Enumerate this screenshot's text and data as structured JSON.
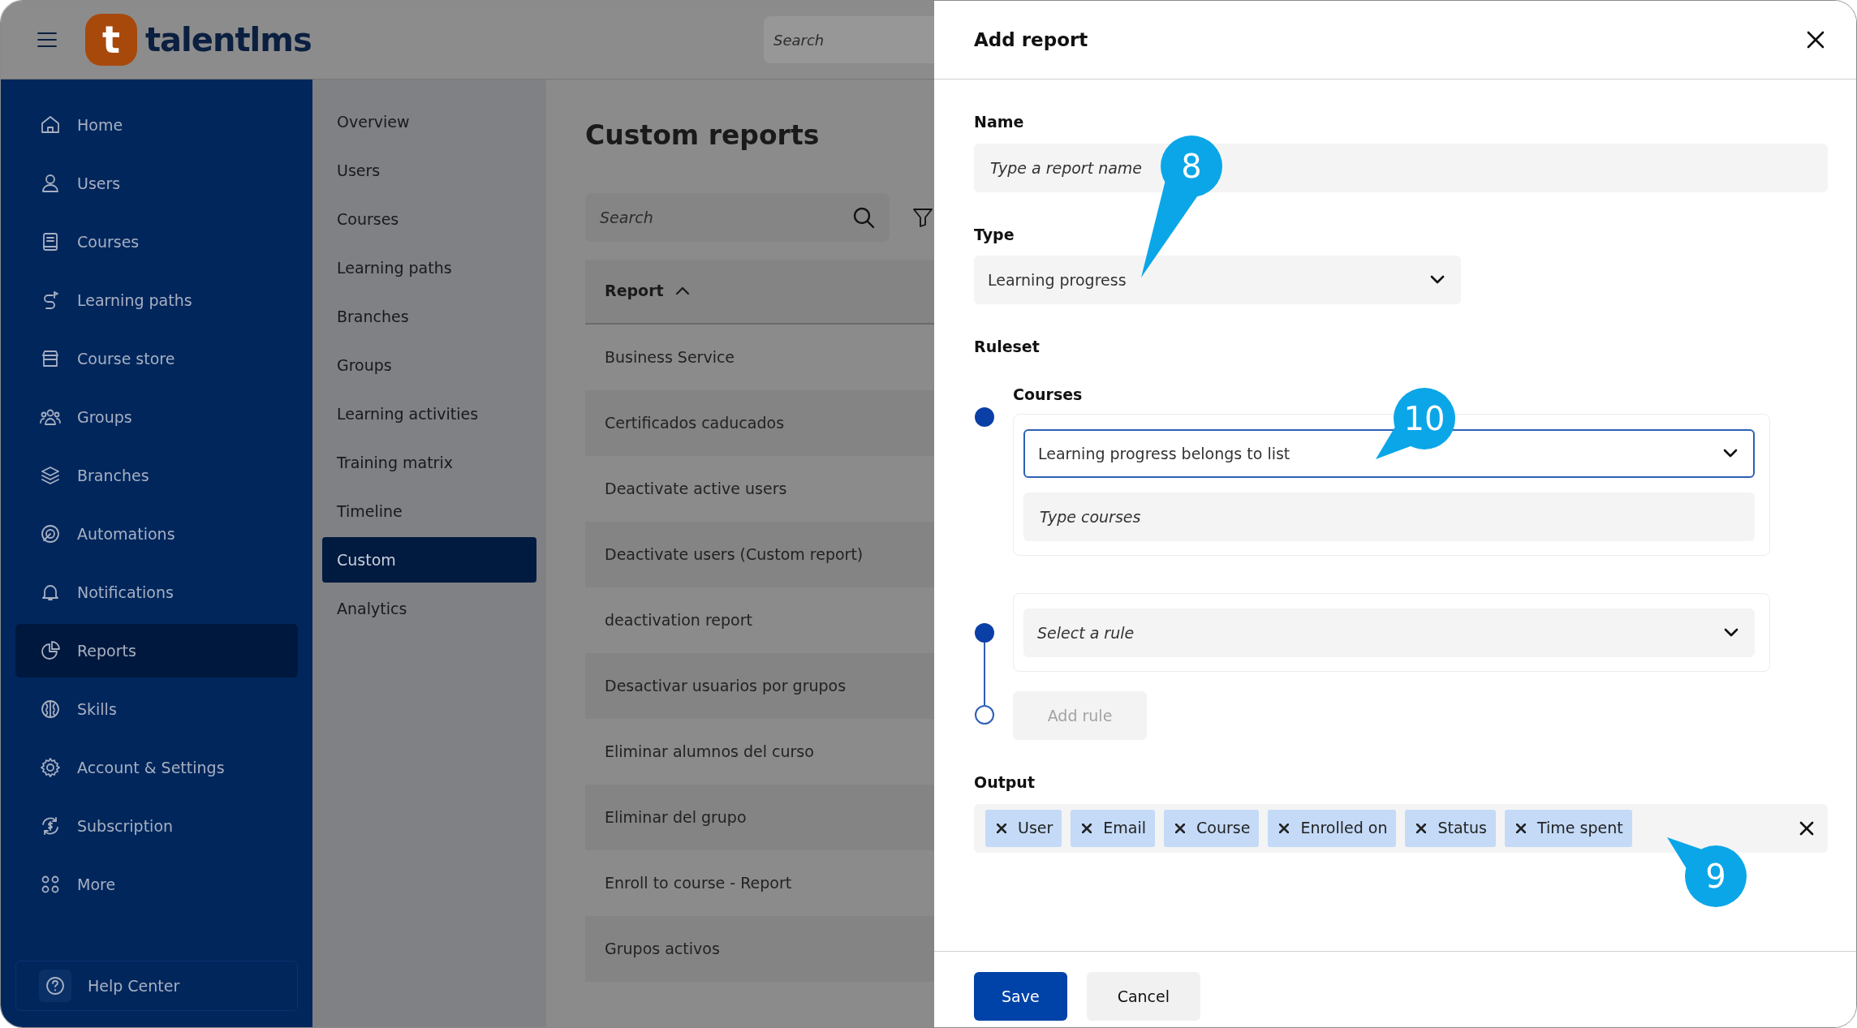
{
  "top_bar": {
    "logo_mark": "t",
    "logo": "talentlms",
    "search": {
      "placeholder": "Search"
    }
  },
  "sidebar": {
    "items": [
      {
        "label": "Home",
        "selected": false
      },
      {
        "label": "Users",
        "selected": false
      },
      {
        "label": "Courses",
        "selected": false
      },
      {
        "label": "Learning paths",
        "selected": false
      },
      {
        "label": "Course store",
        "selected": false
      },
      {
        "label": "Groups",
        "selected": false
      },
      {
        "label": "Branches",
        "selected": false
      },
      {
        "label": "Automations",
        "selected": false
      },
      {
        "label": "Notifications",
        "selected": false
      },
      {
        "label": "Reports",
        "selected": true
      },
      {
        "label": "Skills",
        "selected": false
      },
      {
        "label": "Account & Settings",
        "selected": false
      },
      {
        "label": "Subscription",
        "selected": false
      },
      {
        "label": "More",
        "selected": false
      }
    ],
    "help": "Help Center"
  },
  "subnav": {
    "items": [
      {
        "label": "Overview",
        "selected": false
      },
      {
        "label": "Users",
        "selected": false
      },
      {
        "label": "Courses",
        "selected": false
      },
      {
        "label": "Learning paths",
        "selected": false
      },
      {
        "label": "Branches",
        "selected": false
      },
      {
        "label": "Groups",
        "selected": false
      },
      {
        "label": "Learning activities",
        "selected": false
      },
      {
        "label": "Training matrix",
        "selected": false
      },
      {
        "label": "Timeline",
        "selected": false
      },
      {
        "label": "Custom",
        "selected": true
      },
      {
        "label": "Analytics",
        "selected": false
      }
    ]
  },
  "main": {
    "title": "Custom reports",
    "search": {
      "placeholder": "Search"
    },
    "table": {
      "columns": [
        {
          "label": "Report",
          "sorted": true
        }
      ],
      "rows": [
        {
          "report": "Business Service"
        },
        {
          "report": "Certificados caducados"
        },
        {
          "report": "Deactivate active users"
        },
        {
          "report": "Deactivate users (Custom report)"
        },
        {
          "report": "deactivation report"
        },
        {
          "report": "Desactivar usuarios por grupos"
        },
        {
          "report": "Eliminar alumnos del curso"
        },
        {
          "report": "Eliminar del grupo"
        },
        {
          "report": "Enroll to course - Report"
        },
        {
          "report": "Grupos activos"
        }
      ]
    }
  },
  "panel": {
    "title": "Add report",
    "name": {
      "label": "Name",
      "placeholder": "Type a report name"
    },
    "type": {
      "label": "Type",
      "value": "Learning progress",
      "callout": "8"
    },
    "ruleset": {
      "label": "Ruleset",
      "rules": [
        {
          "label": "Courses",
          "condition": {
            "value": "Learning progress belongs to list",
            "focused": true,
            "callout": "10"
          },
          "input": {
            "placeholder": "Type courses"
          }
        },
        {
          "condition": {
            "placeholder": "Select a rule",
            "focused": false
          }
        }
      ],
      "add_button": {
        "label": "Add rule",
        "disabled": true
      }
    },
    "output": {
      "label": "Output",
      "callout": "9",
      "chips": [
        {
          "label": "User"
        },
        {
          "label": "Email"
        },
        {
          "label": "Course"
        },
        {
          "label": "Enrolled on"
        },
        {
          "label": "Status"
        },
        {
          "label": "Time spent"
        }
      ]
    },
    "buttons": [
      {
        "label": "Save",
        "kind": "primary"
      },
      {
        "label": "Cancel",
        "kind": "secondary"
      }
    ]
  }
}
